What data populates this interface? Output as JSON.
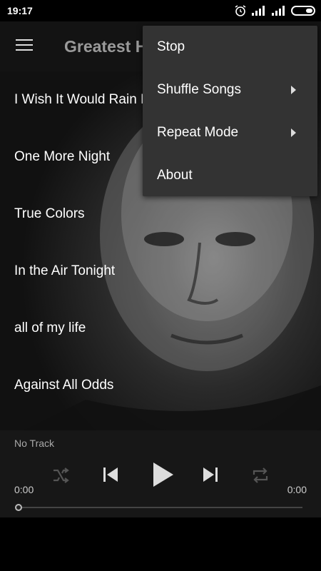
{
  "status_bar": {
    "time": "19:17",
    "icons": [
      "alarm-icon",
      "signal-icon",
      "signal-icon",
      "battery-icon"
    ]
  },
  "app_bar": {
    "title": "Greatest Hits",
    "menu_icon": "hamburger-menu-icon"
  },
  "songs": [
    "I Wish It Would Rain Down",
    "One More Night",
    "True Colors",
    "In the Air Tonight",
    "all of my life",
    "Against All Odds"
  ],
  "player": {
    "now_playing": "No Track",
    "time_elapsed": "0:00",
    "time_total": "0:00",
    "progress": 0,
    "controls": [
      "shuffle-icon",
      "previous-icon",
      "play-icon",
      "next-icon",
      "repeat-icon"
    ]
  },
  "overflow_menu": {
    "items": [
      {
        "label": "Stop",
        "has_submenu": false
      },
      {
        "label": "Shuffle Songs",
        "has_submenu": true
      },
      {
        "label": "Repeat Mode",
        "has_submenu": true
      },
      {
        "label": "About",
        "has_submenu": false
      }
    ]
  },
  "colors": {
    "menu_bg": "#333333",
    "app_bar_bg": "#141414",
    "title_gray": "#9a9a9a"
  }
}
